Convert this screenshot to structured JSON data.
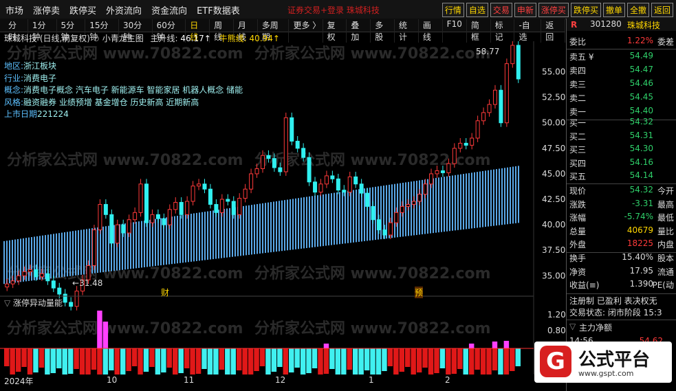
{
  "topbar": {
    "menu": [
      "市场",
      "涨停卖",
      "跌停买",
      "外资流向",
      "资金流向",
      "ETF数据表"
    ],
    "title": "证券交易+登录 珠城科技",
    "buttons": [
      "行情",
      "自选",
      "交易",
      "申新",
      "涨停买",
      "跌停买",
      "撤单",
      "全撤",
      "返回"
    ]
  },
  "toolbar": {
    "items": [
      "分时",
      "1分钟",
      "5分钟",
      "15分钟",
      "30分钟",
      "60分钟",
      "日线",
      "周线",
      "月线",
      "多周期",
      "更多 〉",
      "复权",
      "叠加",
      "多股",
      "统计",
      "画线",
      "F10",
      "简框",
      "标记",
      "-自选",
      "返回"
    ],
    "active_index": 6
  },
  "legend": {
    "stock": "珠城科技 (日线,前复权)",
    "indicator": "小青龙主图",
    "main_label": "主升线:",
    "main_value": "46.17↑",
    "bull_label": "牛熊线:",
    "bull_value": "40.94↑"
  },
  "info": [
    {
      "k": "地区:",
      "v": "浙江板块"
    },
    {
      "k": "行业:",
      "v": "消费电子"
    },
    {
      "k": "概念:",
      "v": "消费电子概念 汽车电子 新能源车 智能家居 机器人概念 储能"
    },
    {
      "k": "风格:",
      "v": "融资融券 业绩预增 基金增仓 历史新高 近期新高"
    },
    {
      "k": "上市日期",
      "v": "221224"
    }
  ],
  "price_axis": [
    "55.00",
    "52.50",
    "50.00",
    "47.50",
    "45.00",
    "42.50",
    "40.00",
    "37.50",
    "35.00"
  ],
  "annotations": {
    "high": "58.77",
    "low": "31.48",
    "marker1": "财",
    "marker2": "预"
  },
  "sub_indicator": {
    "title": "涨停异动量能",
    "axis": [
      "1.20",
      "0.80"
    ]
  },
  "x_labels": [
    "2024年",
    "10",
    "11",
    "12",
    "1",
    "2"
  ],
  "quote": {
    "code": "301280",
    "name": "珠城科技",
    "wei_bi_label": "委比",
    "wei_bi": "1.22%",
    "wei_cha_label": "委差",
    "asks": [
      {
        "label": "卖五 ¥",
        "price": "54.49"
      },
      {
        "label": "卖四",
        "price": "54.47"
      },
      {
        "label": "卖三",
        "price": "54.46"
      },
      {
        "label": "卖二",
        "price": "54.45"
      },
      {
        "label": "卖一",
        "price": "54.40"
      }
    ],
    "bids": [
      {
        "label": "买一",
        "price": "54.32"
      },
      {
        "label": "买二",
        "price": "54.31"
      },
      {
        "label": "买三",
        "price": "54.30"
      },
      {
        "label": "买四",
        "price": "54.16"
      },
      {
        "label": "买五",
        "price": "54.14"
      }
    ],
    "stats": [
      {
        "l": "现价",
        "v": "54.32",
        "r": "今开",
        "c": "grn"
      },
      {
        "l": "涨跌",
        "v": "-3.31",
        "r": "最高",
        "c": "grn"
      },
      {
        "l": "涨幅",
        "v": "-5.74%",
        "r": "最低",
        "c": "grn"
      },
      {
        "l": "总量",
        "v": "40679",
        "r": "量比",
        "c": "yel"
      },
      {
        "l": "外盘",
        "v": "18225",
        "r": "内盘",
        "c": "red"
      }
    ],
    "stats2": [
      {
        "l": "换手",
        "v": "15.40%",
        "r": "股本"
      },
      {
        "l": "净资",
        "v": "17.95",
        "r": "流通"
      },
      {
        "l": "收益(≡)",
        "v": "1.390",
        "r": "PE(动"
      }
    ],
    "reg_line": "注册制 已盈利 表决权无",
    "trade_status": "交易状态: 闭市阶段 15:3",
    "net_label": "主力净额",
    "tick_time": "14:56",
    "tick_price": "54.62"
  },
  "logo": {
    "mark": "G",
    "name": "公式平台",
    "url": "www.gspt.com"
  },
  "watermark": "分析家公式网 www.70822.com",
  "chart_data": {
    "type": "candlestick",
    "y_axis_ticks": [
      35,
      37.5,
      40,
      42.5,
      45,
      47.5,
      50,
      52.5,
      55
    ],
    "ylim": [
      33,
      58
    ],
    "close": [
      34.2,
      34.5,
      35.0,
      35.4,
      35.6,
      34.9,
      35.2,
      34.5,
      33.8,
      33.2,
      32.4,
      32.0,
      33.5,
      34.6,
      36.0,
      39.5,
      42.0,
      41.0,
      38.2,
      40.0,
      39.2,
      40.5,
      41.2,
      44.0,
      40.2,
      41.0,
      40.6,
      40.0,
      41.5,
      42.2,
      41.0,
      42.3,
      43.8,
      44.0,
      43.5,
      42.0,
      41.2,
      42.5,
      42.3,
      41.0,
      42.6,
      43.5,
      45.0,
      45.5,
      46.8,
      46.5,
      45.6,
      45.2,
      50.5,
      48.2,
      47.5,
      46.6,
      44.2,
      43.2,
      44.0,
      44.8,
      44.5,
      43.4,
      43.2,
      44.7,
      44.0,
      43.1,
      41.8,
      40.5,
      39.5,
      39.0,
      40.2,
      41.2,
      41.8,
      42.0,
      42.3,
      43.0,
      44.0,
      45.0,
      45.3,
      45.1,
      46.0,
      47.5,
      48.0,
      47.8,
      48.5,
      50.2,
      51.0,
      51.8,
      53.2,
      50.0,
      55.8,
      57.6,
      54.3
    ]
  }
}
